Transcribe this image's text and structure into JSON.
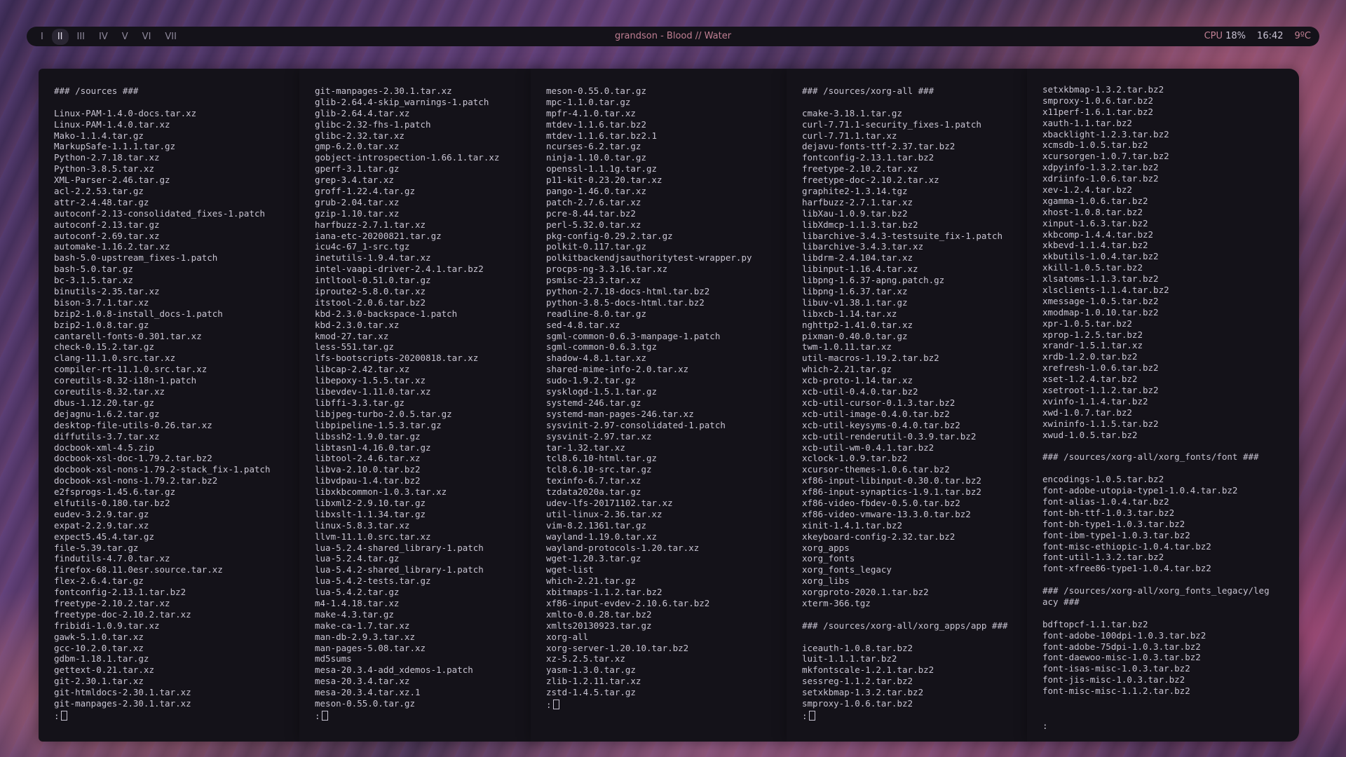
{
  "bar": {
    "workspaces": [
      "I",
      "II",
      "III",
      "IV",
      "V",
      "VI",
      "VII"
    ],
    "active_workspace": 1,
    "title": "grandson - Blood // Water",
    "cpu_label": "CPU",
    "cpu_value": "18%",
    "time": "16:42",
    "temp": "9ºC"
  },
  "terminals": [
    {
      "lines": [
        "### /sources ###",
        "",
        "Linux-PAM-1.4.0-docs.tar.xz",
        "Linux-PAM-1.4.0.tar.xz",
        "Mako-1.1.4.tar.gz",
        "MarkupSafe-1.1.1.tar.gz",
        "Python-2.7.18.tar.xz",
        "Python-3.8.5.tar.xz",
        "XML-Parser-2.46.tar.gz",
        "acl-2.2.53.tar.gz",
        "attr-2.4.48.tar.gz",
        "autoconf-2.13-consolidated_fixes-1.patch",
        "autoconf-2.13.tar.gz",
        "autoconf-2.69.tar.xz",
        "automake-1.16.2.tar.xz",
        "bash-5.0-upstream_fixes-1.patch",
        "bash-5.0.tar.gz",
        "bc-3.1.5.tar.xz",
        "binutils-2.35.tar.xz",
        "bison-3.7.1.tar.xz",
        "bzip2-1.0.8-install_docs-1.patch",
        "bzip2-1.0.8.tar.gz",
        "cantarell-fonts-0.301.tar.xz",
        "check-0.15.2.tar.gz",
        "clang-11.1.0.src.tar.xz",
        "compiler-rt-11.1.0.src.tar.xz",
        "coreutils-8.32-i18n-1.patch",
        "coreutils-8.32.tar.xz",
        "dbus-1.12.20.tar.gz",
        "dejagnu-1.6.2.tar.gz",
        "desktop-file-utils-0.26.tar.xz",
        "diffutils-3.7.tar.xz",
        "docbook-xml-4.5.zip",
        "docbook-xsl-doc-1.79.2.tar.bz2",
        "docbook-xsl-nons-1.79.2-stack_fix-1.patch",
        "docbook-xsl-nons-1.79.2.tar.bz2",
        "e2fsprogs-1.45.6.tar.gz",
        "elfutils-0.180.tar.bz2",
        "eudev-3.2.9.tar.gz",
        "expat-2.2.9.tar.xz",
        "expect5.45.4.tar.gz",
        "file-5.39.tar.gz",
        "findutils-4.7.0.tar.xz",
        "firefox-68.11.0esr.source.tar.xz",
        "flex-2.6.4.tar.gz",
        "fontconfig-2.13.1.tar.bz2",
        "freetype-2.10.2.tar.xz",
        "freetype-doc-2.10.2.tar.xz",
        "fribidi-1.0.9.tar.xz",
        "gawk-5.1.0.tar.xz",
        "gcc-10.2.0.tar.xz",
        "gdbm-1.18.1.tar.gz",
        "gettext-0.21.tar.xz",
        "git-2.30.1.tar.xz",
        "git-htmldocs-2.30.1.tar.xz",
        "git-manpages-2.30.1.tar.xz"
      ],
      "prompt": ":"
    },
    {
      "lines": [
        "git-manpages-2.30.1.tar.xz",
        "glib-2.64.4-skip_warnings-1.patch",
        "glib-2.64.4.tar.xz",
        "glibc-2.32-fhs-1.patch",
        "glibc-2.32.tar.xz",
        "gmp-6.2.0.tar.xz",
        "gobject-introspection-1.66.1.tar.xz",
        "gperf-3.1.tar.gz",
        "grep-3.4.tar.xz",
        "groff-1.22.4.tar.gz",
        "grub-2.04.tar.xz",
        "gzip-1.10.tar.xz",
        "harfbuzz-2.7.1.tar.xz",
        "iana-etc-20200821.tar.gz",
        "icu4c-67_1-src.tgz",
        "inetutils-1.9.4.tar.xz",
        "intel-vaapi-driver-2.4.1.tar.bz2",
        "intltool-0.51.0.tar.gz",
        "iproute2-5.8.0.tar.xz",
        "itstool-2.0.6.tar.bz2",
        "kbd-2.3.0-backspace-1.patch",
        "kbd-2.3.0.tar.xz",
        "kmod-27.tar.xz",
        "less-551.tar.gz",
        "lfs-bootscripts-20200818.tar.xz",
        "libcap-2.42.tar.xz",
        "libepoxy-1.5.5.tar.xz",
        "libevdev-1.11.0.tar.xz",
        "libffi-3.3.tar.gz",
        "libjpeg-turbo-2.0.5.tar.gz",
        "libpipeline-1.5.3.tar.gz",
        "libssh2-1.9.0.tar.gz",
        "libtasn1-4.16.0.tar.gz",
        "libtool-2.4.6.tar.xz",
        "libva-2.10.0.tar.bz2",
        "libvdpau-1.4.tar.bz2",
        "libxkbcommon-1.0.3.tar.xz",
        "libxml2-2.9.10.tar.gz",
        "libxslt-1.1.34.tar.gz",
        "linux-5.8.3.tar.xz",
        "llvm-11.1.0.src.tar.xz",
        "lua-5.2.4-shared_library-1.patch",
        "lua-5.2.4.tar.gz",
        "lua-5.4.2-shared_library-1.patch",
        "lua-5.4.2-tests.tar.gz",
        "lua-5.4.2.tar.gz",
        "m4-1.4.18.tar.xz",
        "make-4.3.tar.gz",
        "make-ca-1.7.tar.xz",
        "man-db-2.9.3.tar.xz",
        "man-pages-5.08.tar.xz",
        "md5sums",
        "mesa-20.3.4-add_xdemos-1.patch",
        "mesa-20.3.4.tar.xz",
        "mesa-20.3.4.tar.xz.1",
        "meson-0.55.0.tar.gz"
      ],
      "prompt": ":"
    },
    {
      "lines": [
        "meson-0.55.0.tar.gz",
        "mpc-1.1.0.tar.gz",
        "mpfr-4.1.0.tar.xz",
        "mtdev-1.1.6.tar.bz2",
        "mtdev-1.1.6.tar.bz2.1",
        "ncurses-6.2.tar.gz",
        "ninja-1.10.0.tar.gz",
        "openssl-1.1.1g.tar.gz",
        "p11-kit-0.23.20.tar.xz",
        "pango-1.46.0.tar.xz",
        "patch-2.7.6.tar.xz",
        "pcre-8.44.tar.bz2",
        "perl-5.32.0.tar.xz",
        "pkg-config-0.29.2.tar.gz",
        "polkit-0.117.tar.gz",
        "polkitbackendjsauthoritytest-wrapper.py",
        "procps-ng-3.3.16.tar.xz",
        "psmisc-23.3.tar.xz",
        "python-2.7.18-docs-html.tar.bz2",
        "python-3.8.5-docs-html.tar.bz2",
        "readline-8.0.tar.gz",
        "sed-4.8.tar.xz",
        "sgml-common-0.6.3-manpage-1.patch",
        "sgml-common-0.6.3.tgz",
        "shadow-4.8.1.tar.xz",
        "shared-mime-info-2.0.tar.xz",
        "sudo-1.9.2.tar.gz",
        "sysklogd-1.5.1.tar.gz",
        "systemd-246.tar.gz",
        "systemd-man-pages-246.tar.xz",
        "sysvinit-2.97-consolidated-1.patch",
        "sysvinit-2.97.tar.xz",
        "tar-1.32.tar.xz",
        "tcl8.6.10-html.tar.gz",
        "tcl8.6.10-src.tar.gz",
        "texinfo-6.7.tar.xz",
        "tzdata2020a.tar.gz",
        "udev-lfs-20171102.tar.xz",
        "util-linux-2.36.tar.xz",
        "vim-8.2.1361.tar.gz",
        "wayland-1.19.0.tar.xz",
        "wayland-protocols-1.20.tar.xz",
        "wget-1.20.3.tar.gz",
        "wget-list",
        "which-2.21.tar.gz",
        "xbitmaps-1.1.2.tar.bz2",
        "xf86-input-evdev-2.10.6.tar.bz2",
        "xmlto-0.0.28.tar.bz2",
        "xmlts20130923.tar.gz",
        "xorg-all",
        "xorg-server-1.20.10.tar.bz2",
        "xz-5.2.5.tar.xz",
        "yasm-1.3.0.tar.gz",
        "zlib-1.2.11.tar.xz",
        "zstd-1.4.5.tar.gz"
      ],
      "prompt": ":"
    },
    {
      "lines": [
        "### /sources/xorg-all ###",
        "",
        "cmake-3.18.1.tar.gz",
        "curl-7.71.1-security_fixes-1.patch",
        "curl-7.71.1.tar.xz",
        "dejavu-fonts-ttf-2.37.tar.bz2",
        "fontconfig-2.13.1.tar.bz2",
        "freetype-2.10.2.tar.xz",
        "freetype-doc-2.10.2.tar.xz",
        "graphite2-1.3.14.tgz",
        "harfbuzz-2.7.1.tar.xz",
        "libXau-1.0.9.tar.bz2",
        "libXdmcp-1.1.3.tar.bz2",
        "libarchive-3.4.3-testsuite_fix-1.patch",
        "libarchive-3.4.3.tar.xz",
        "libdrm-2.4.104.tar.xz",
        "libinput-1.16.4.tar.xz",
        "libpng-1.6.37-apng.patch.gz",
        "libpng-1.6.37.tar.xz",
        "libuv-v1.38.1.tar.gz",
        "libxcb-1.14.tar.xz",
        "nghttp2-1.41.0.tar.xz",
        "pixman-0.40.0.tar.gz",
        "twm-1.0.11.tar.xz",
        "util-macros-1.19.2.tar.bz2",
        "which-2.21.tar.gz",
        "xcb-proto-1.14.tar.xz",
        "xcb-util-0.4.0.tar.bz2",
        "xcb-util-cursor-0.1.3.tar.bz2",
        "xcb-util-image-0.4.0.tar.bz2",
        "xcb-util-keysyms-0.4.0.tar.bz2",
        "xcb-util-renderutil-0.3.9.tar.bz2",
        "xcb-util-wm-0.4.1.tar.bz2",
        "xclock-1.0.9.tar.bz2",
        "xcursor-themes-1.0.6.tar.bz2",
        "xf86-input-libinput-0.30.0.tar.bz2",
        "xf86-input-synaptics-1.9.1.tar.bz2",
        "xf86-video-fbdev-0.5.0.tar.bz2",
        "xf86-video-vmware-13.3.0.tar.bz2",
        "xinit-1.4.1.tar.bz2",
        "xkeyboard-config-2.32.tar.bz2",
        "xorg_apps",
        "xorg_fonts",
        "xorg_fonts_legacy",
        "xorg_libs",
        "xorgproto-2020.1.tar.bz2",
        "xterm-366.tgz",
        "",
        "### /sources/xorg-all/xorg_apps/app ###",
        "",
        "iceauth-1.0.8.tar.bz2",
        "luit-1.1.1.tar.bz2",
        "mkfontscale-1.2.1.tar.bz2",
        "sessreg-1.1.2.tar.bz2",
        "setxkbmap-1.3.2.tar.bz2",
        "smproxy-1.0.6.tar.bz2"
      ],
      "prompt": ":"
    },
    {
      "lines": [
        "setxkbmap-1.3.2.tar.bz2",
        "smproxy-1.0.6.tar.bz2",
        "x11perf-1.6.1.tar.bz2",
        "xauth-1.1.tar.bz2",
        "xbacklight-1.2.3.tar.bz2",
        "xcmsdb-1.0.5.tar.bz2",
        "xcursorgen-1.0.7.tar.bz2",
        "xdpyinfo-1.3.2.tar.bz2",
        "xdriinfo-1.0.6.tar.bz2",
        "xev-1.2.4.tar.bz2",
        "xgamma-1.0.6.tar.bz2",
        "xhost-1.0.8.tar.bz2",
        "xinput-1.6.3.tar.bz2",
        "xkbcomp-1.4.4.tar.bz2",
        "xkbevd-1.1.4.tar.bz2",
        "xkbutils-1.0.4.tar.bz2",
        "xkill-1.0.5.tar.bz2",
        "xlsatoms-1.1.3.tar.bz2",
        "xlsclients-1.1.4.tar.bz2",
        "xmessage-1.0.5.tar.bz2",
        "xmodmap-1.0.10.tar.bz2",
        "xpr-1.0.5.tar.bz2",
        "xprop-1.2.5.tar.bz2",
        "xrandr-1.5.1.tar.xz",
        "xrdb-1.2.0.tar.bz2",
        "xrefresh-1.0.6.tar.bz2",
        "xset-1.2.4.tar.bz2",
        "xsetroot-1.1.2.tar.bz2",
        "xvinfo-1.1.4.tar.bz2",
        "xwd-1.0.7.tar.bz2",
        "xwininfo-1.1.5.tar.bz2",
        "xwud-1.0.5.tar.bz2",
        "",
        "### /sources/xorg-all/xorg_fonts/font ###",
        "",
        "encodings-1.0.5.tar.bz2",
        "font-adobe-utopia-type1-1.0.4.tar.bz2",
        "font-alias-1.0.4.tar.bz2",
        "font-bh-ttf-1.0.3.tar.bz2",
        "font-bh-type1-1.0.3.tar.bz2",
        "font-ibm-type1-1.0.3.tar.bz2",
        "font-misc-ethiopic-1.0.4.tar.bz2",
        "font-util-1.3.2.tar.bz2",
        "font-xfree86-type1-1.0.4.tar.bz2",
        "",
        "### /sources/xorg-all/xorg_fonts_legacy/leg",
        "acy ###",
        "",
        "bdftopcf-1.1.tar.bz2",
        "font-adobe-100dpi-1.0.3.tar.bz2",
        "font-adobe-75dpi-1.0.3.tar.bz2",
        "font-daewoo-misc-1.0.3.tar.bz2",
        "font-isas-misc-1.0.3.tar.bz2",
        "font-jis-misc-1.0.3.tar.bz2",
        "font-misc-misc-1.1.2.tar.bz2",
        "",
        ""
      ],
      "prompt": ":"
    }
  ]
}
